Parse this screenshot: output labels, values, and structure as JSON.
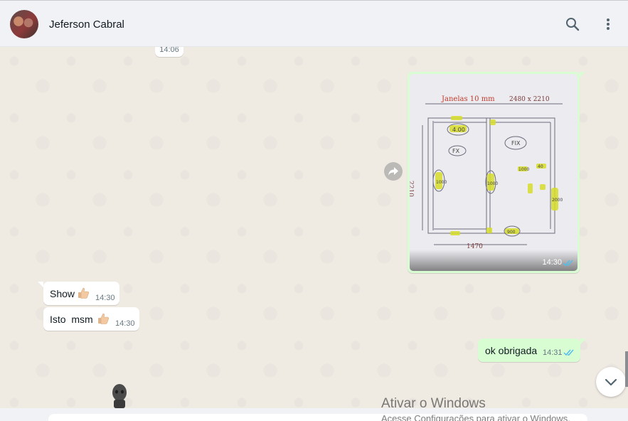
{
  "header": {
    "contact_name": "Jeferson Cabral",
    "icons": {
      "search": "search-icon",
      "menu": "kebab-menu-icon",
      "avatar": "contact-avatar"
    }
  },
  "chat": {
    "date_chip": "14:06",
    "image_message": {
      "time": "14:30",
      "status": "read",
      "sketch": {
        "title": "Janelas 10 mm",
        "top_dims": "2480 x 2210",
        "side_dim": "2210",
        "bottom_dim": "1470",
        "labels": [
          "4.00",
          "FX",
          "FIX",
          "1000",
          "1000",
          "1000",
          "2000",
          "40",
          "900"
        ]
      }
    },
    "incoming": [
      {
        "text": "Show",
        "emoji": "thumbs-up",
        "time": "14:30"
      },
      {
        "text": "Isto  msm",
        "emoji": "thumbs-up",
        "time": "14:30"
      }
    ],
    "outgoing": {
      "text": "ok obrigada",
      "time": "14:31",
      "status": "read"
    }
  },
  "watermark": {
    "title": "Ativar o Windows",
    "subtitle": "Acesse Configurações para ativar o Windows."
  },
  "colors": {
    "header_bg": "#f0f2f5",
    "chat_bg": "#efeae2",
    "outgoing_bubble": "#d9fdd3",
    "incoming_bubble": "#ffffff",
    "read_ticks": "#53bdeb"
  }
}
